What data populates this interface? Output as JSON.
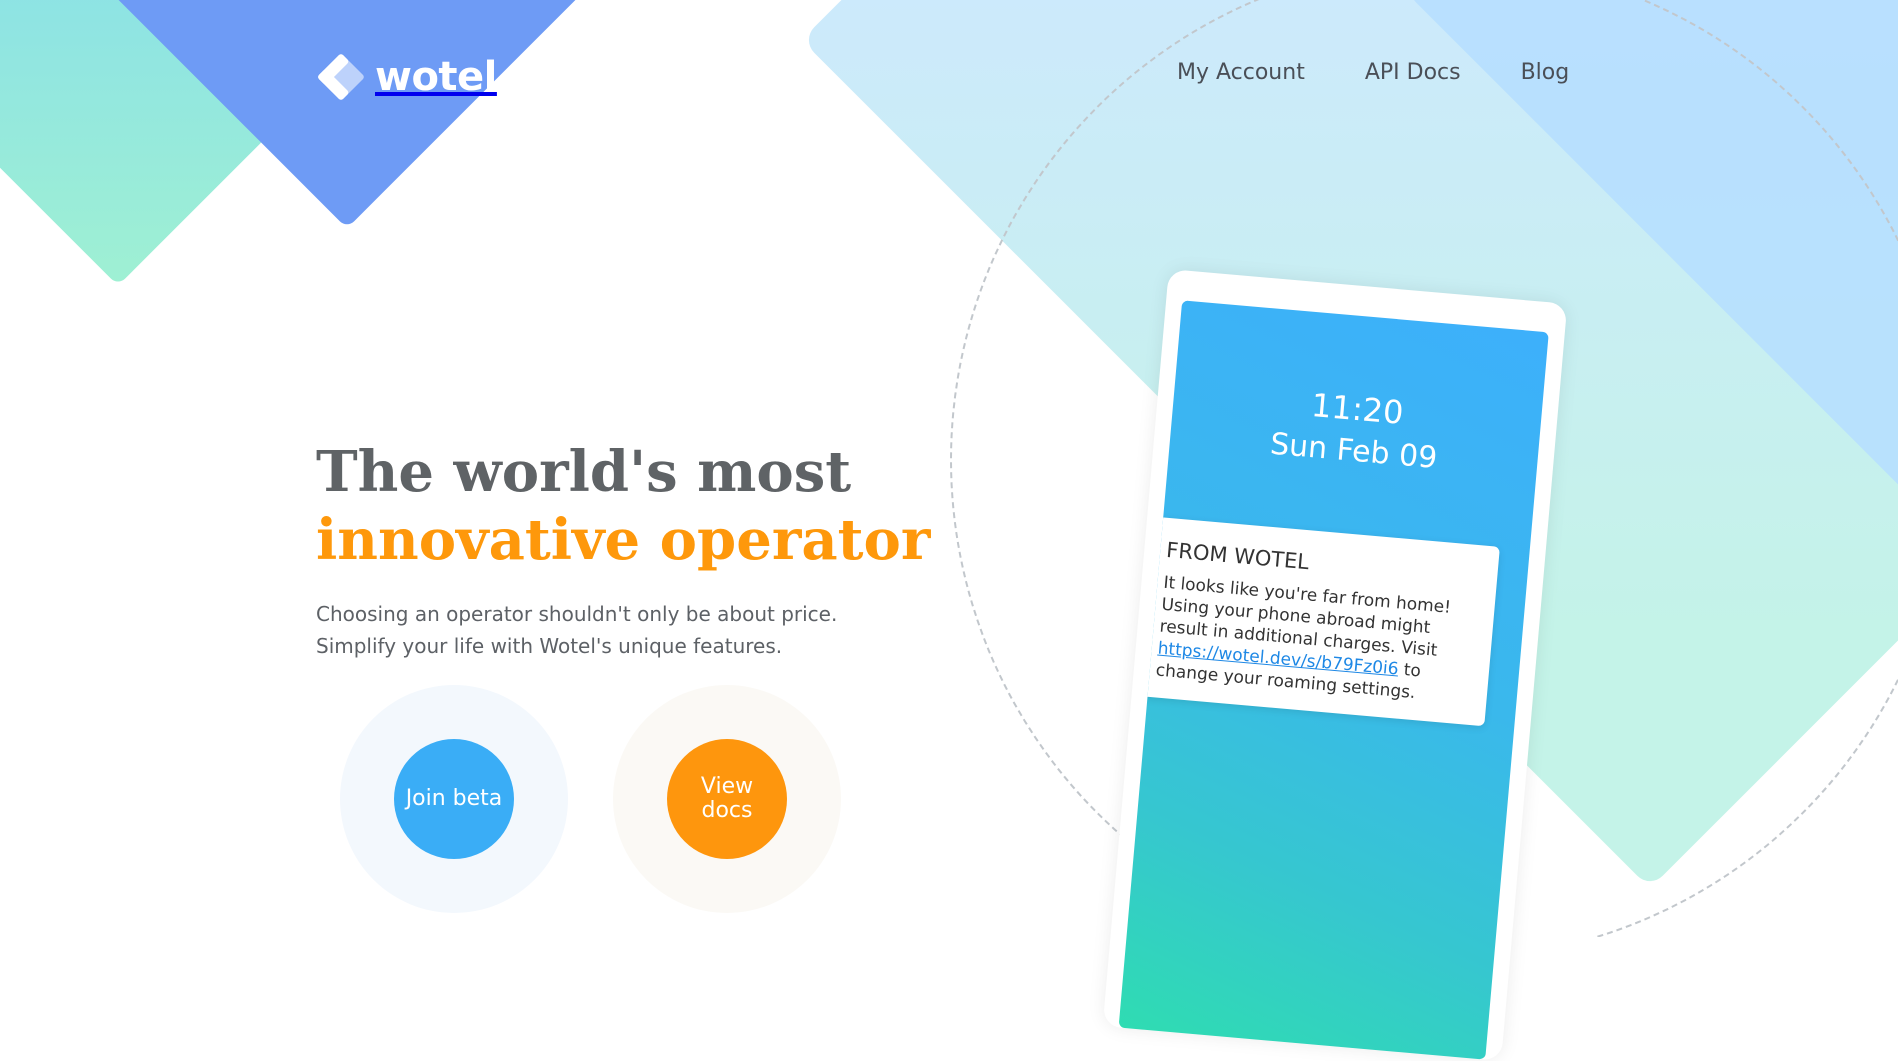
{
  "brand": {
    "name": "wotel"
  },
  "nav": {
    "items": [
      "My Account",
      "API Docs",
      "Blog"
    ]
  },
  "hero": {
    "title_line1": "The world's most",
    "title_line2": "innovative operator",
    "subtitle_line1": "Choosing an operator shouldn't only be about price.",
    "subtitle_line2": "Simplify your life with Wotel's unique features."
  },
  "cta": {
    "join_label": "Join beta",
    "docs_label": "View docs"
  },
  "phone": {
    "time": "11:20",
    "date": "Sun Feb 09",
    "notification": {
      "title": "FROM WOTEL",
      "body_before": "It looks like you're far from home! Using your phone abroad might result in additional charges. Visit",
      "link": "https://wotel.dev/s/b79Fz0i6",
      "body_after": "to change your roaming settings."
    }
  },
  "colors": {
    "accent_orange": "#fe980b",
    "accent_blue": "#3aadf6",
    "heading_gray": "#5f6366",
    "shape_blue": "#6e9bf5",
    "shape_mint": "#9ff0d3"
  }
}
